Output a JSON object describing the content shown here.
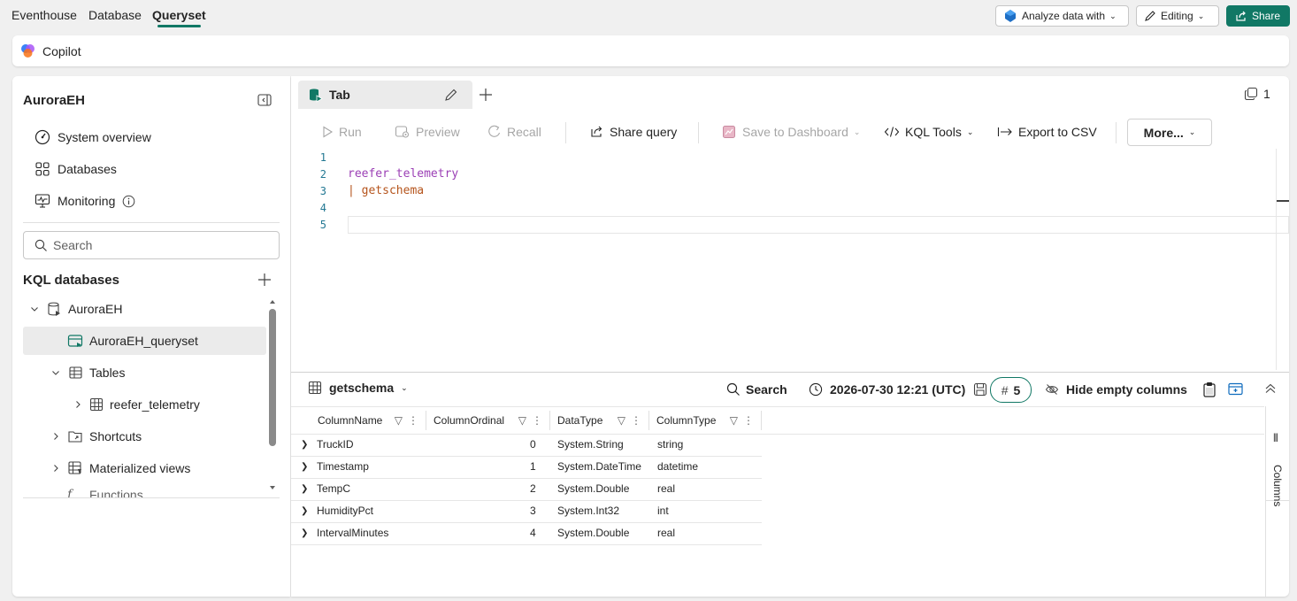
{
  "topbar": {
    "nav": [
      "Eventhouse",
      "Database",
      "Queryset"
    ],
    "active_nav": "Queryset",
    "analyze_label": "Analyze data with",
    "editing_label": "Editing",
    "share_label": "Share"
  },
  "copilot": {
    "label": "Copilot"
  },
  "sidebar": {
    "title": "AuroraEH",
    "items": [
      "System overview",
      "Databases",
      "Monitoring"
    ],
    "search_placeholder": "Search",
    "section_title": "KQL databases",
    "tree": {
      "database": "AuroraEH",
      "queryset": "AuroraEH_queryset",
      "tables": "Tables",
      "table": "reefer_telemetry",
      "shortcuts": "Shortcuts",
      "materialized_views": "Materialized views",
      "partial": "Functions"
    }
  },
  "editor": {
    "tab_label": "Tab",
    "tab_count": "1",
    "toolbar": {
      "run": "Run",
      "preview": "Preview",
      "recall": "Recall",
      "share_query": "Share query",
      "save_dashboard": "Save to Dashboard",
      "kql_tools": "KQL Tools",
      "export_csv": "Export to CSV",
      "more": "More..."
    },
    "line_numbers": [
      "1",
      "2",
      "3",
      "4",
      "5"
    ],
    "lines": [
      "",
      "reefer_telemetry",
      "| getschema",
      "",
      ""
    ]
  },
  "results": {
    "title": "getschema",
    "search_label": "Search",
    "timestamp": "2026-07-30 12:21 (UTC)",
    "row_count": "5",
    "hide_empty": "Hide empty columns",
    "columns_panel": "Columns",
    "columns": [
      "ColumnName",
      "ColumnOrdinal",
      "DataType",
      "ColumnType"
    ],
    "rows": [
      [
        "TruckID",
        "0",
        "System.String",
        "string"
      ],
      [
        "Timestamp",
        "1",
        "System.DateTime",
        "datetime"
      ],
      [
        "TempC",
        "2",
        "System.Double",
        "real"
      ],
      [
        "HumidityPct",
        "3",
        "System.Int32",
        "int"
      ],
      [
        "IntervalMinutes",
        "4",
        "System.Double",
        "real"
      ]
    ]
  }
}
